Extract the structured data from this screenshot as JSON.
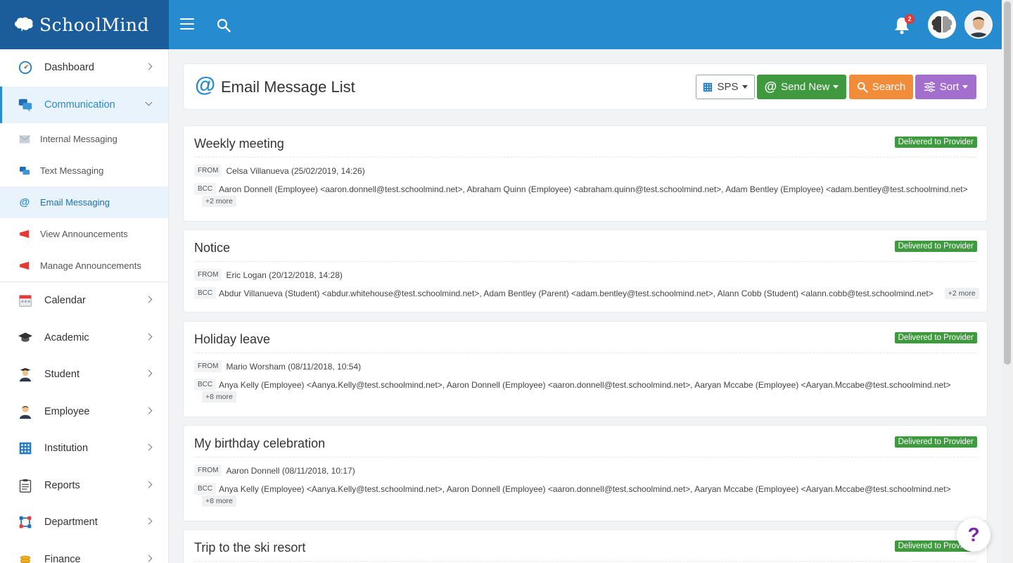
{
  "brand": {
    "name": "SchoolMind"
  },
  "topbar": {
    "notification_count": "2"
  },
  "sidebar": {
    "items": [
      {
        "label": "Dashboard",
        "icon": "dashboard-icon"
      },
      {
        "label": "Communication",
        "icon": "chat-icon"
      },
      {
        "label": "Calendar",
        "icon": "calendar-icon"
      },
      {
        "label": "Academic",
        "icon": "graduation-cap-icon"
      },
      {
        "label": "Student",
        "icon": "student-icon"
      },
      {
        "label": "Employee",
        "icon": "employee-icon"
      },
      {
        "label": "Institution",
        "icon": "building-icon"
      },
      {
        "label": "Reports",
        "icon": "clipboard-icon"
      },
      {
        "label": "Department",
        "icon": "department-icon"
      },
      {
        "label": "Finance",
        "icon": "coins-icon"
      }
    ],
    "sub_items": [
      {
        "label": "Internal Messaging",
        "icon": "envelope-icon"
      },
      {
        "label": "Text Messaging",
        "icon": "chat-icon"
      },
      {
        "label": "Email Messaging",
        "icon": "at-icon"
      },
      {
        "label": "View Announcements",
        "icon": "megaphone-icon"
      },
      {
        "label": "Manage Announcements",
        "icon": "megaphone-icon"
      }
    ]
  },
  "header": {
    "icon": "@",
    "title": "Email Message List",
    "sps_label": "SPS",
    "send_label": "Send New",
    "search_label": "Search",
    "sort_label": "Sort"
  },
  "labels": {
    "from": "FROM",
    "bcc": "BCC"
  },
  "messages": [
    {
      "subject": "Weekly meeting",
      "status": "Delivered to Provider",
      "from": "Celsa Villanueva (25/02/2019, 14:26)",
      "bcc": "Aaron Donnell (Employee) <aaron.donnell@test.schoolmind.net>, Abraham Quinn (Employee) <abraham.quinn@test.schoolmind.net>, Adam Bentley (Employee) <adam.bentley@test.schoolmind.net>",
      "more": "+2 more"
    },
    {
      "subject": "Notice",
      "status": "Delivered to Provider",
      "from": "Eric Logan (20/12/2018, 14:28)",
      "bcc": "Abdur Villanueva (Student) <abdur.whitehouse@test.schoolmind.net>, Adam Bentley (Parent) <adam.bentley@test.schoolmind.net>, Alann Cobb (Student) <alann.cobb@test.schoolmind.net>",
      "more": "+2 more"
    },
    {
      "subject": "Holiday leave",
      "status": "Delivered to Provider",
      "from": "Mario Worsham (08/11/2018, 10:54)",
      "bcc": "Anya Kelly (Employee) <Aanya.Kelly@test.schoolmind.net>, Aaron Donnell (Employee) <aaron.donnell@test.schoolmind.net>, Aaryan Mccabe (Employee) <Aaryan.Mccabe@test.schoolmind.net>",
      "more": "+8 more"
    },
    {
      "subject": "My birthday celebration",
      "status": "Delivered to Provider",
      "from": "Aaron Donnell (08/11/2018, 10:17)",
      "bcc": "Anya Kelly (Employee) <Aanya.Kelly@test.schoolmind.net>, Aaron Donnell (Employee) <aaron.donnell@test.schoolmind.net>, Aaryan Mccabe (Employee) <Aaryan.Mccabe@test.schoolmind.net>",
      "more": "+8 more"
    },
    {
      "subject": "Trip to the ski resort",
      "status": "Delivered to Provider"
    }
  ],
  "help": {
    "label": "?"
  }
}
